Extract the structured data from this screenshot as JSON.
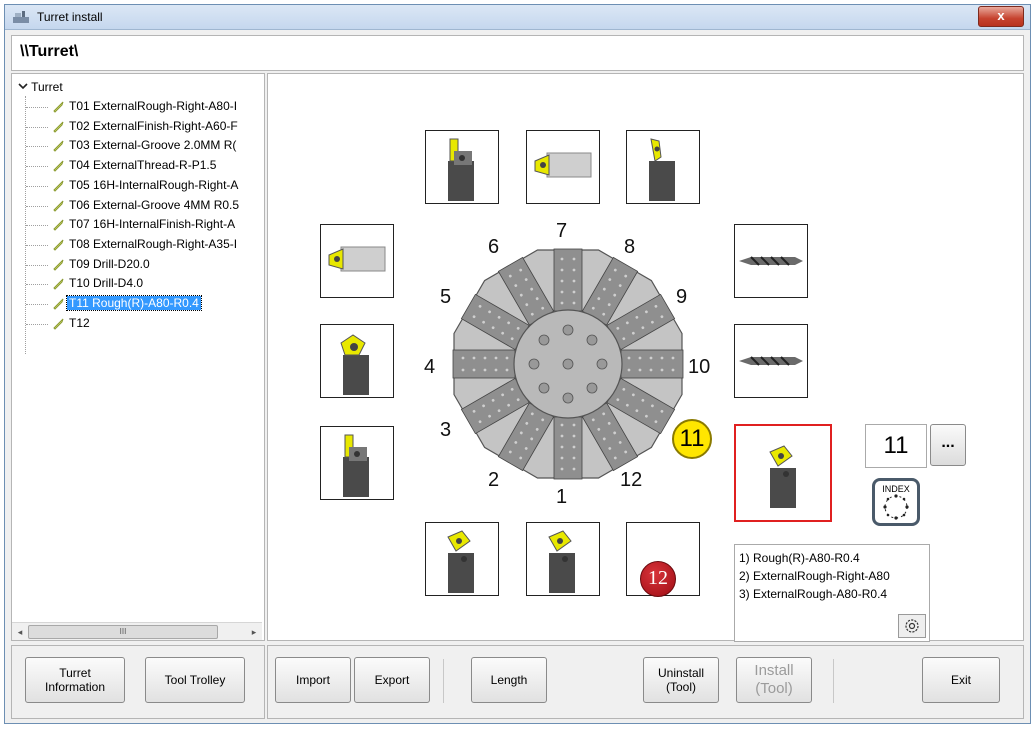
{
  "window": {
    "title": "Turret install",
    "close_label": "x"
  },
  "path": "\\\\Turret\\",
  "tree": {
    "root_label": "Turret",
    "items": [
      {
        "label": "T01 ExternalRough-Right-A80-I"
      },
      {
        "label": "T02 ExternalFinish-Right-A60-F"
      },
      {
        "label": "T03 External-Groove 2.0MM R("
      },
      {
        "label": "T04 ExternalThread-R-P1.5"
      },
      {
        "label": "T05 16H-InternalRough-Right-A"
      },
      {
        "label": "T06 External-Groove 4MM R0.5"
      },
      {
        "label": "T07 16H-InternalFinish-Right-A"
      },
      {
        "label": "T08 ExternalRough-Right-A35-I"
      },
      {
        "label": "T09 Drill-D20.0"
      },
      {
        "label": "T10 Drill-D4.0"
      },
      {
        "label": "T11 Rough(R)-A80-R0.4",
        "selected": true
      },
      {
        "label": "T12"
      }
    ],
    "scrollbar_grip": "III"
  },
  "turret": {
    "positions": [
      "1",
      "2",
      "3",
      "4",
      "5",
      "6",
      "7",
      "8",
      "9",
      "10",
      "11",
      "12"
    ],
    "highlighted": "11",
    "slot_tools": {
      "1": "turning-tool-icon",
      "2": "turning-tool-icon",
      "3": "grooving-tool-icon",
      "4": "threading-tool-icon",
      "5": "boring-bar-icon",
      "6": "grooving-tool-icon",
      "7": "boring-bar-icon",
      "8": "finishing-tool-icon",
      "9": "drill-icon",
      "10": "drill-icon",
      "11": "turning-tool-icon",
      "12": "empty"
    }
  },
  "selection": {
    "tool_number": "11",
    "more_label": "...",
    "index_label": "INDEX",
    "info_lines": [
      "1) Rough(R)-A80-R0.4",
      "2) ExternalRough-Right-A80",
      "3) ExternalRough-A80-R0.4"
    ],
    "badge_12": "12"
  },
  "buttons": {
    "turret_information": "Turret\nInformation",
    "tool_trolley": "Tool Trolley",
    "import": "Import",
    "export": "Export",
    "length": "Length",
    "uninstall": "Uninstall\n(Tool)",
    "install": "Install\n(Tool)",
    "exit": "Exit"
  },
  "colors": {
    "selection": "#3399ff",
    "active_slot_border": "#e02020",
    "badge_yellow": "#ffe600",
    "badge_red": "#b01218"
  }
}
